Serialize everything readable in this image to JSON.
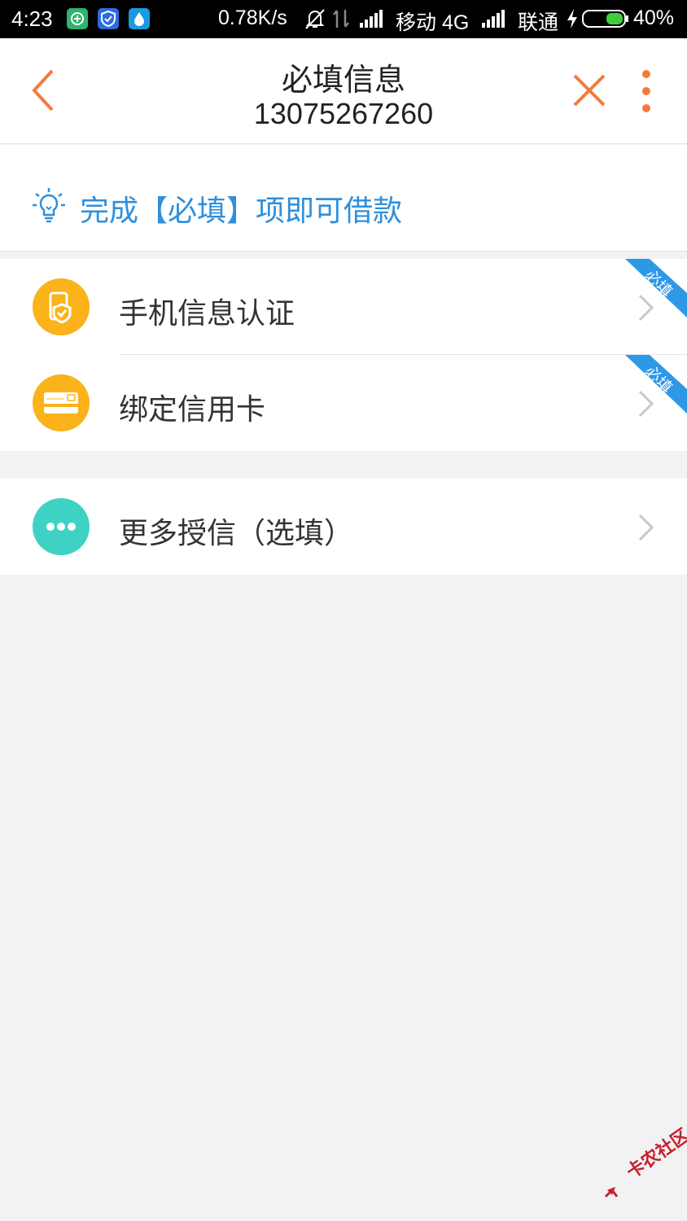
{
  "status_bar": {
    "time": "4:23",
    "speed": "0.78K/s",
    "carrier1": "移动 4G",
    "carrier2": "联通",
    "battery": "40%"
  },
  "header": {
    "title": "必填信息",
    "subtitle": "13075267260",
    "accent_color": "#f47a3c"
  },
  "notice": {
    "text": "完成【必填】项即可借款",
    "color": "#2f8fdb"
  },
  "required_items": [
    {
      "label": "手机信息认证",
      "badge": "必填",
      "icon": "phone-shield-icon"
    },
    {
      "label": "绑定信用卡",
      "badge": "必填",
      "icon": "credit-card-icon"
    }
  ],
  "optional_items": [
    {
      "label": "更多授信（选填）",
      "icon": "more-dots-icon"
    }
  ],
  "watermark": "卡农社区"
}
